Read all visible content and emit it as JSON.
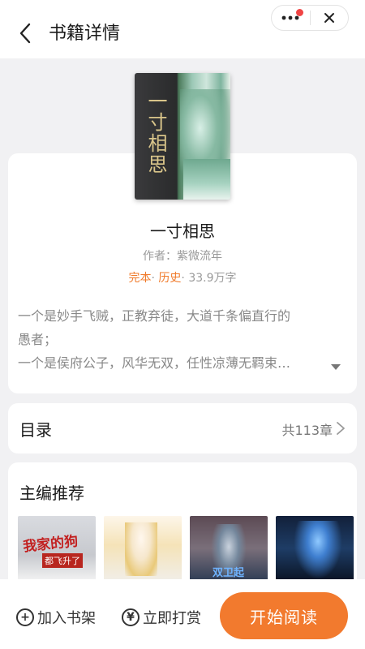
{
  "header": {
    "title": "书籍详情"
  },
  "book": {
    "title": "一寸相思",
    "author_line": "作者：紫微流年",
    "status_tag": "完本",
    "genre_tag": "历史",
    "word_count": "33.9万字",
    "cover_text": "一寸相思",
    "description_line1": "一个是妙手飞贼，正教弃徒，大道千条偏直行的",
    "description_line2": "愚者；",
    "description_line3": "一个是侯府公子，风华无双，任性凉薄无羁束…"
  },
  "toc": {
    "label": "目录",
    "count": "共113章"
  },
  "recommend": {
    "title": "主编推荐",
    "items": [
      {
        "cover_text_top": "我家的狗",
        "cover_text_sub": "都飞升了"
      },
      {
        "cover_text_top": ""
      },
      {
        "cover_text_top": "双卫起"
      },
      {
        "cover_text_top": ""
      }
    ]
  },
  "bottom_bar": {
    "add_shelf": "加入书架",
    "reward": "立即打赏",
    "start_read": "开始阅读",
    "add_icon_glyph": "+",
    "reward_icon_glyph": "¥"
  },
  "colors": {
    "accent": "#f27a2e",
    "tag_orange": "#f07a2a",
    "notification_dot": "#f04444"
  }
}
